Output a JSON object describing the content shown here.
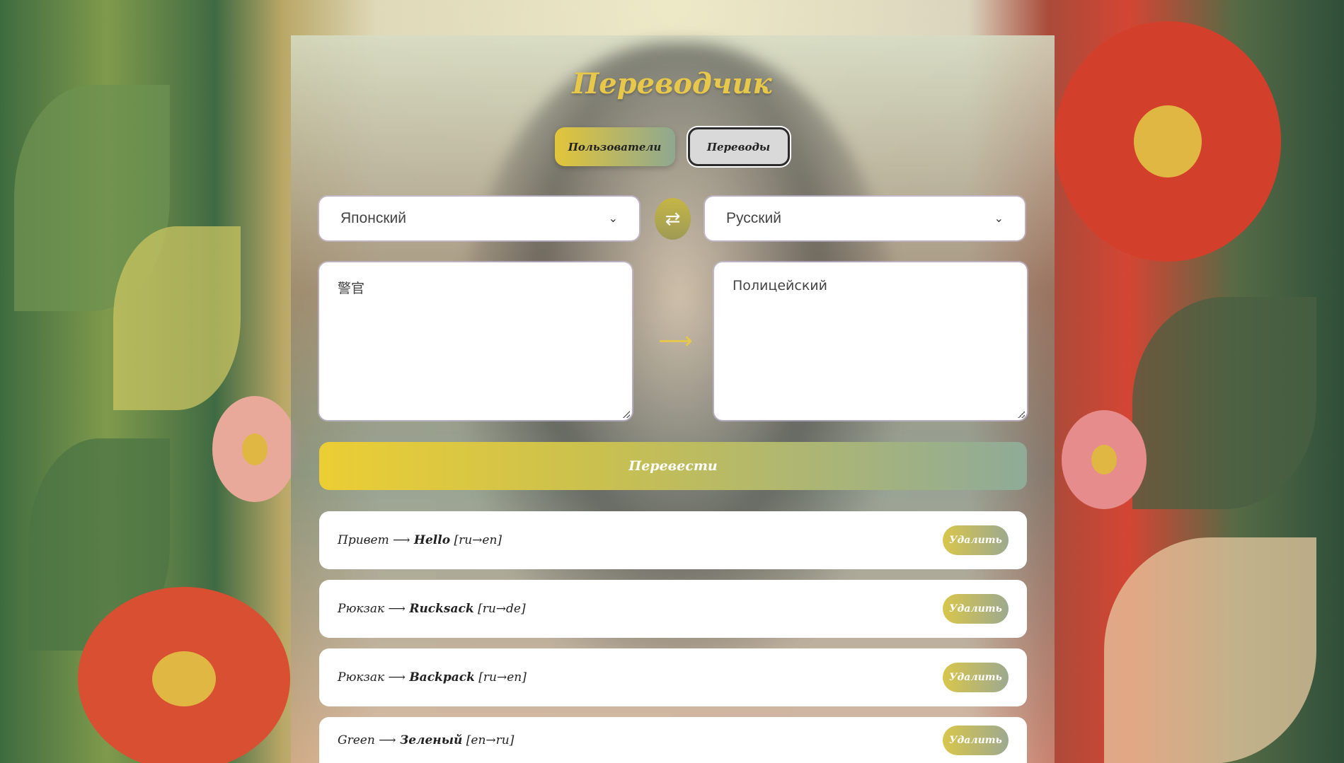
{
  "app": {
    "title": "Переводчик"
  },
  "tabs": [
    {
      "label": "Пользователи"
    },
    {
      "label": "Переводы"
    }
  ],
  "source_language": {
    "selected": "Японский"
  },
  "target_language": {
    "selected": "Русский"
  },
  "source_text": "警官",
  "target_text": "Полицейский",
  "translate_button": {
    "label": "Перевести"
  },
  "history": [
    {
      "source": "Привет",
      "target": "Hello",
      "pair": "[ru→en]",
      "delete_label": "Удалить"
    },
    {
      "source": "Рюкзак",
      "target": "Rucksack",
      "pair": "[ru→de]",
      "delete_label": "Удалить"
    },
    {
      "source": "Рюкзак",
      "target": "Backpack",
      "pair": "[ru→en]",
      "delete_label": "Удалить"
    },
    {
      "source": "Green",
      "target": "Зеленый",
      "pair": "[en→ru]",
      "delete_label": "Удалить"
    }
  ],
  "colors": {
    "accent": "#e8c84a",
    "gradient_start": "#ecce34",
    "gradient_end": "#8fab98"
  }
}
